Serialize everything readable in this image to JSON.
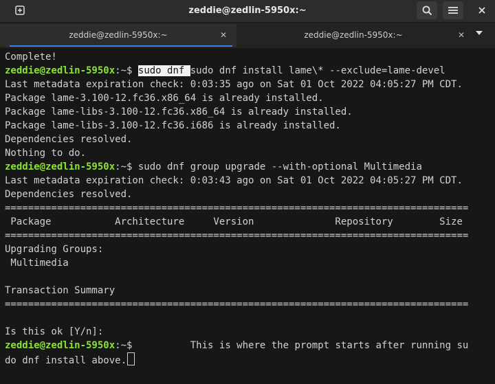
{
  "window": {
    "title": "zeddie@zedlin-5950x:~"
  },
  "tabs": [
    {
      "label": "zeddie@zedlin-5950x:~"
    },
    {
      "label": "zeddie@zedlin-5950x:~"
    }
  ],
  "icons": {
    "new_tab": "plus-square-icon",
    "search": "search-icon",
    "menu": "hamburger-menu-icon",
    "close": "close-icon",
    "tab_close": "close-icon",
    "tab_overflow": "chevron-down-icon"
  },
  "colors": {
    "prompt": "#8ae234",
    "tab_accent": "#3584e4",
    "background": "#171717",
    "text": "#d2d2d2"
  },
  "terminal": {
    "prompt_user": "zeddie@zedlin-5950x",
    "prompt_suffix": ":~$",
    "lines": {
      "l0": "Complete!",
      "l1_highlight": "sudo dnf ",
      "l1_cmd": "sudo dnf install lame\\* --exclude=lame-devel",
      "l2": "Last metadata expiration check: 0:03:35 ago on Sat 01 Oct 2022 04:05:27 PM CDT.",
      "l3": "Package lame-3.100-12.fc36.x86_64 is already installed.",
      "l4": "Package lame-libs-3.100-12.fc36.x86_64 is already installed.",
      "l5": "Package lame-libs-3.100-12.fc36.i686 is already installed.",
      "l6": "Dependencies resolved.",
      "l7": "Nothing to do.",
      "l8_cmd": " sudo dnf group upgrade --with-optional Multimedia",
      "l9": "Last metadata expiration check: 0:03:43 ago on Sat 01 Oct 2022 04:05:27 PM CDT.",
      "l10": "Dependencies resolved.",
      "l11": "================================================================================",
      "l12": " Package           Architecture     Version              Repository        Size",
      "l13": "================================================================================",
      "l14": "Upgrading Groups:",
      "l15": " Multimedia",
      "l16": "",
      "l17": "Transaction Summary",
      "l18": "================================================================================",
      "l19": "",
      "l20": "Is this ok [Y/n]:",
      "l21_text": "          This is where the prompt starts after running su",
      "l22": "do dnf install above."
    }
  }
}
